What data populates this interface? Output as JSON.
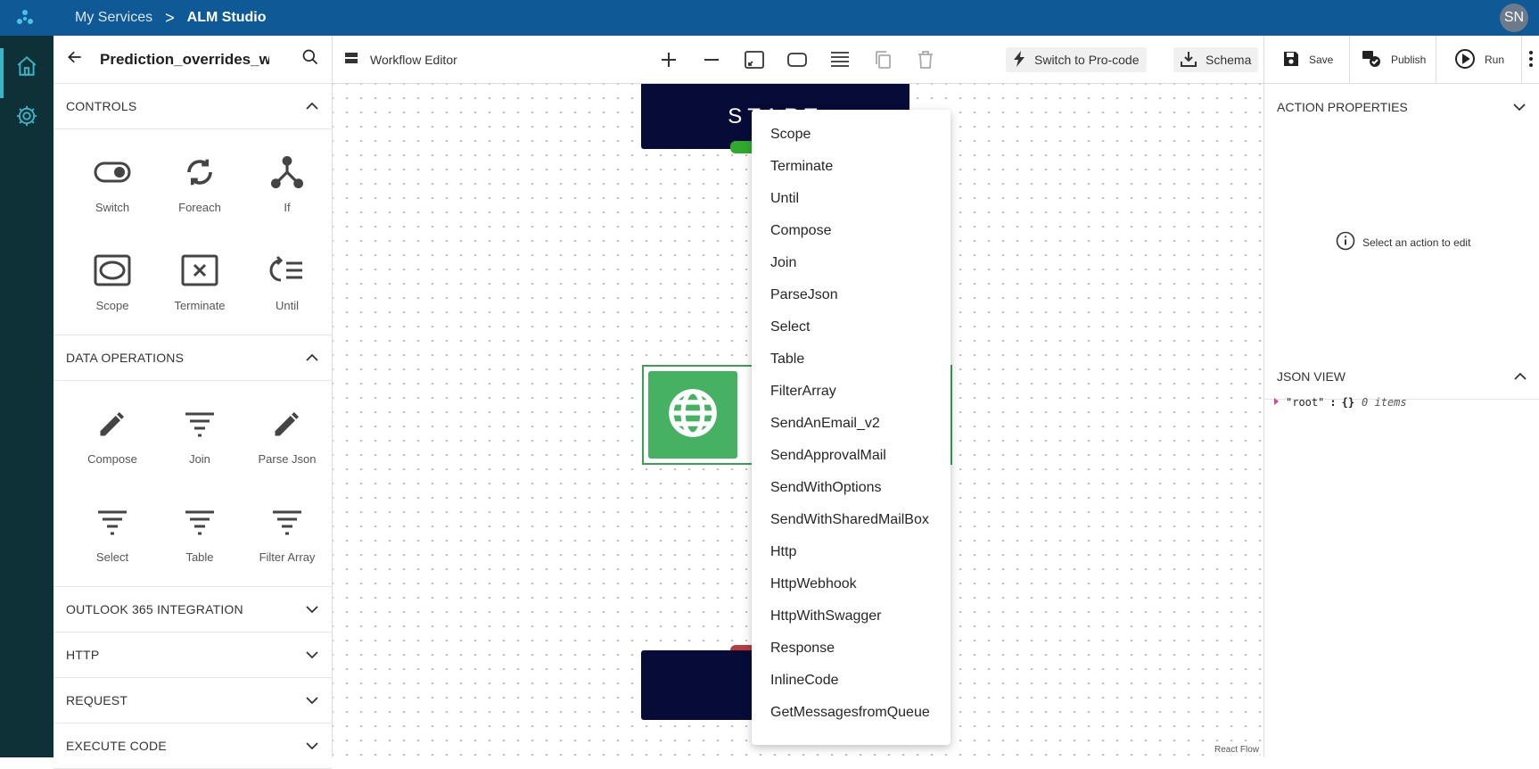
{
  "topbar": {
    "breadcrumb_parent": "My Services",
    "breadcrumb_separator": ">",
    "breadcrumb_current": "ALM Studio",
    "user_initials": "SN"
  },
  "left_panel": {
    "title": "Prediction_overrides_wc",
    "sections": {
      "controls": {
        "title": "CONTROLS",
        "items": [
          "Switch",
          "Foreach",
          "If",
          "Scope",
          "Terminate",
          "Until"
        ]
      },
      "data_operations": {
        "title": "DATA OPERATIONS",
        "items": [
          "Compose",
          "Join",
          "Parse Json",
          "Select",
          "Table",
          "Filter Array"
        ]
      },
      "outlook": {
        "title": "OUTLOOK 365 INTEGRATION"
      },
      "http": {
        "title": "HTTP"
      },
      "request": {
        "title": "REQUEST"
      },
      "execute_code": {
        "title": "EXECUTE CODE"
      }
    }
  },
  "toolbar": {
    "title": "Workflow Editor",
    "switch_label": "Switch to Pro-code",
    "schema_label": "Schema",
    "save_label": "Save",
    "publish_label": "Publish",
    "run_label": "Run"
  },
  "canvas": {
    "start_label": "START",
    "react_flow_label": "React Flow"
  },
  "dropdown": {
    "items": [
      "Scope",
      "Terminate",
      "Until",
      "Compose",
      "Join",
      "ParseJson",
      "Select",
      "Table",
      "FilterArray",
      "SendAnEmail_v2",
      "SendApprovalMail",
      "SendWithOptions",
      "SendWithSharedMailBox",
      "Http",
      "HttpWebhook",
      "HttpWithSwagger",
      "Response",
      "InlineCode",
      "GetMessagesfromQueue"
    ]
  },
  "right_panel": {
    "action_properties_title": "ACTION PROPERTIES",
    "hint": "Select an action to edit",
    "json_view_title": "JSON VIEW",
    "json_root_key": "\"root\"",
    "json_colon": ":",
    "json_root_value": "{}",
    "json_root_count": "0 items"
  },
  "colors": {
    "topbar": "#0f5a96",
    "rail": "#0e3138",
    "accent": "#3ab5c8",
    "node_dark": "#070b38",
    "http_green": "#46b162"
  }
}
